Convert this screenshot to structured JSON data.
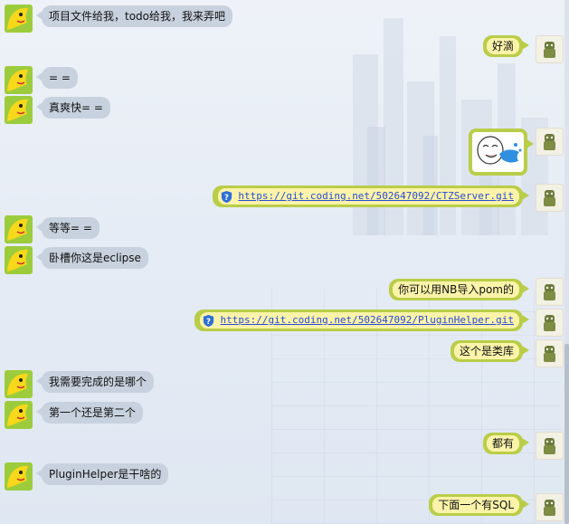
{
  "messages": [
    {
      "side": "left",
      "type": "text",
      "text": "项目文件给我，todo给我，我来弄吧"
    },
    {
      "side": "right",
      "type": "text",
      "text": "好滴"
    },
    {
      "side": "left",
      "type": "text",
      "text": "= ="
    },
    {
      "side": "left",
      "type": "text",
      "text": "真爽快= ="
    },
    {
      "side": "right",
      "type": "sticker",
      "text": ""
    },
    {
      "side": "right",
      "type": "link",
      "text": "https://git.coding.net/502647092/CTZServer.git"
    },
    {
      "side": "left",
      "type": "text",
      "text": "等等= ="
    },
    {
      "side": "left",
      "type": "text",
      "text": "卧槽你这是eclipse"
    },
    {
      "side": "right",
      "type": "text",
      "text": "你可以用NB导入pom的"
    },
    {
      "side": "right",
      "type": "link",
      "text": "https://git.coding.net/502647092/PluginHelper.git"
    },
    {
      "side": "right",
      "type": "text",
      "text": "这个是类库"
    },
    {
      "side": "left",
      "type": "text",
      "text": "我需要完成的是哪个"
    },
    {
      "side": "left",
      "type": "text",
      "text": "第一个还是第二个"
    },
    {
      "side": "right",
      "type": "text",
      "text": "都有"
    },
    {
      "side": "left",
      "type": "text",
      "text": "PluginHelper是干啥的"
    },
    {
      "side": "right",
      "type": "text",
      "text": "下面一个有SQL"
    }
  ],
  "colors": {
    "left_bubble": "#c8d2de",
    "right_bubble_outer": "#b9cd48",
    "right_bubble_inner": "#fbf3a9",
    "link": "#2a4bd6"
  },
  "icons": {
    "left_avatar": "yellow-cartoon-avatar-icon",
    "right_avatar": "green-android-avatar-icon",
    "link_prefix": "shield-question-icon"
  }
}
